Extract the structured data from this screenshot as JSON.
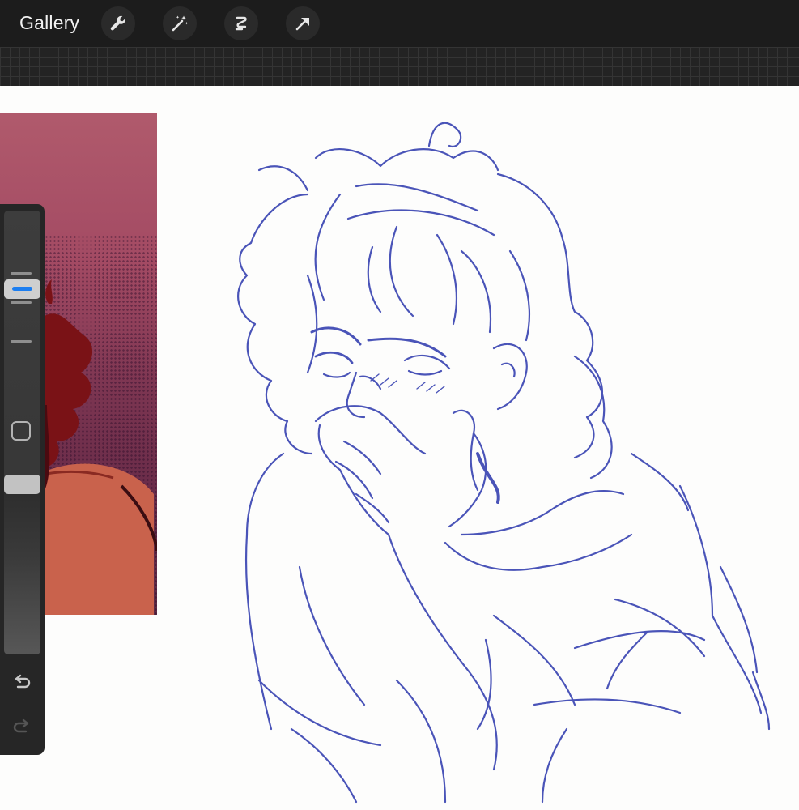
{
  "topbar": {
    "gallery_label": "Gallery",
    "tools": [
      {
        "icon": "wrench-icon",
        "name": "actions"
      },
      {
        "icon": "magic-wand-icon",
        "name": "adjustments"
      },
      {
        "icon": "selection-icon",
        "name": "selection"
      },
      {
        "icon": "arrow-cursor-icon",
        "name": "transform"
      }
    ]
  },
  "sidebar": {
    "brush_size": 0.32,
    "brush_opacity": 1.0,
    "accent_color": "#1d7ef0",
    "undo_icon": "undo-icon",
    "redo_icon": "redo-icon",
    "modify_icon": "square-icon"
  },
  "colors": {
    "ink": "#4a54b8",
    "topbar": "#1c1c1c",
    "canvas": "#fdfdfc"
  }
}
